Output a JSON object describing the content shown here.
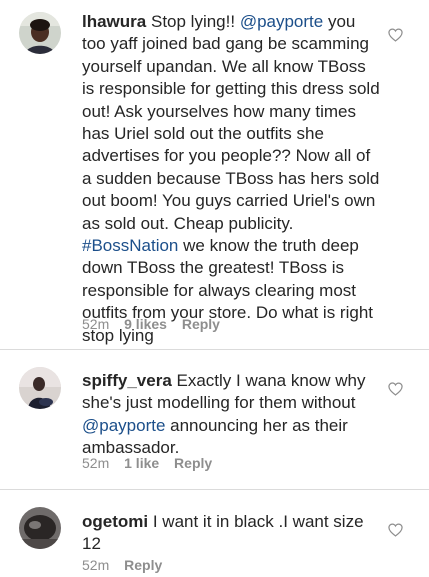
{
  "comments": [
    {
      "username": "lhawura",
      "segments": [
        {
          "t": "Stop lying!! ",
          "k": "text"
        },
        {
          "t": "@payporte",
          "k": "mention"
        },
        {
          "t": " you too yaff joined bad gang be scamming yourself upandan. We all know TBoss is responsible for getting this dress sold out! Ask yourselves how many times has Uriel sold out the outfits she advertises for you people?? Now all of a sudden because TBoss has hers sold out boom! You guys carried Uriel's own as sold out. Cheap publicity. ",
          "k": "text"
        },
        {
          "t": "#BossNation",
          "k": "hashtag"
        },
        {
          "t": " we know the truth deep down TBoss the greatest! TBoss is responsible for always clearing most outfits from your store. Do what is right stop lying",
          "k": "text"
        }
      ],
      "time": "52m",
      "likes": "9 likes",
      "reply": "Reply"
    },
    {
      "username": "spiffy_vera",
      "segments": [
        {
          "t": "Exactly I wana know why she's just modelling for them without ",
          "k": "text"
        },
        {
          "t": "@payporte",
          "k": "mention"
        },
        {
          "t": " announcing her as their ambassador.",
          "k": "text"
        }
      ],
      "time": "52m",
      "likes": "1 like",
      "reply": "Reply"
    },
    {
      "username": "ogetomi",
      "segments": [
        {
          "t": "I want it in black .I want size 12",
          "k": "text"
        }
      ],
      "time": "52m",
      "likes": "",
      "reply": "Reply"
    }
  ],
  "colors": {
    "text": "#262626",
    "link": "#1c4f8a",
    "meta": "#8e8e8e",
    "divider": "#dbdbdb"
  },
  "icons": {
    "like": "heart-outline-icon"
  }
}
